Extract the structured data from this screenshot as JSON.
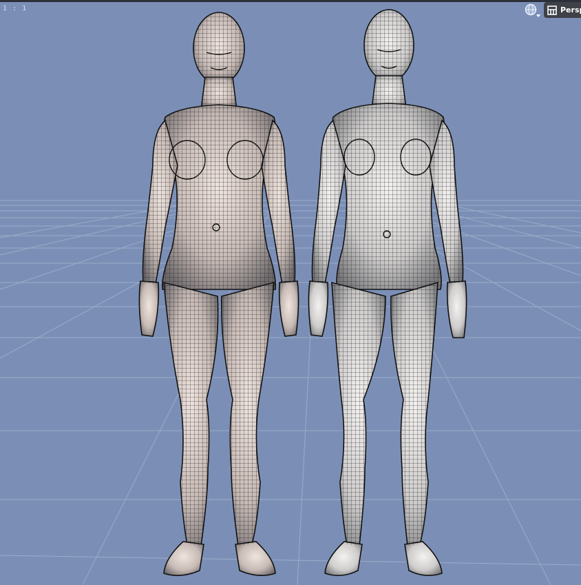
{
  "viewport": {
    "ratio_label": "1 : 1",
    "view_mode_label": "Persp",
    "background_color": "#7b8fb6",
    "grid_color": "#9fb0cd",
    "mesh_fill": "#d9cdc8",
    "wire_color": "#1b1b1e"
  },
  "icons": {
    "camera_globe": "globe-icon",
    "dropdown": "triangle-down-icon",
    "view_layout": "grid-layout-icon"
  },
  "figures": [
    {
      "name": "figure-left"
    },
    {
      "name": "figure-right"
    }
  ]
}
